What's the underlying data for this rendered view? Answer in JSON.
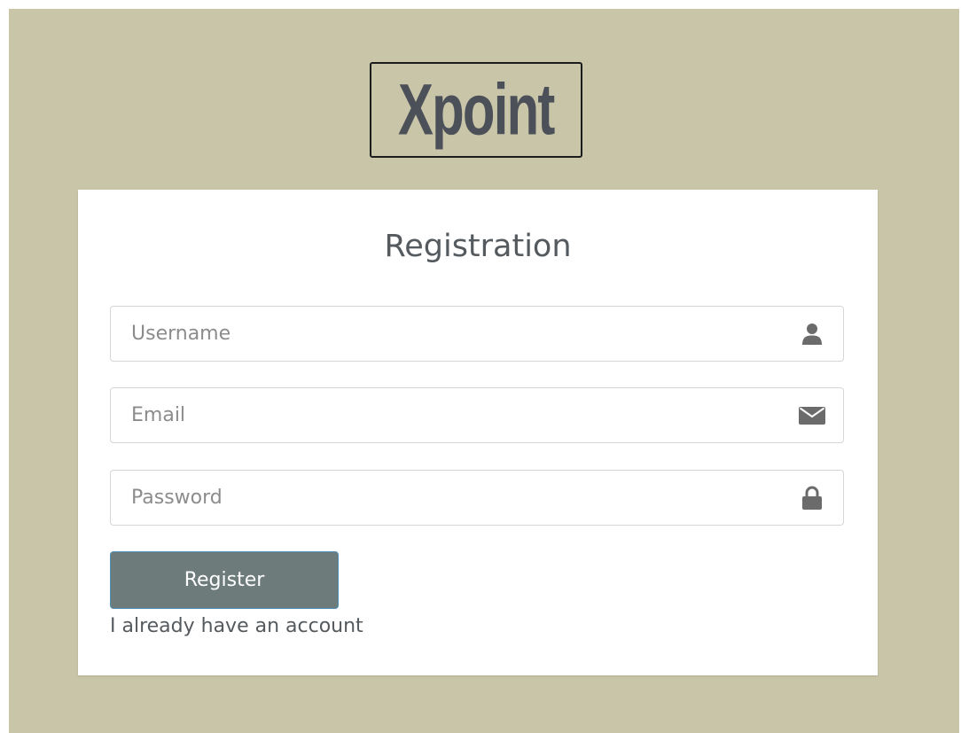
{
  "brand": {
    "logo_text": "Xpoint"
  },
  "form": {
    "title": "Registration",
    "username": {
      "value": "",
      "placeholder": "Username",
      "icon": "user-icon"
    },
    "email": {
      "value": "",
      "placeholder": "Email",
      "icon": "envelope-icon"
    },
    "password": {
      "value": "",
      "placeholder": "Password",
      "icon": "lock-icon"
    },
    "register_label": "Register",
    "login_link_label": "I already have an account"
  },
  "colors": {
    "page_background": "#c9c5a8",
    "card_background": "#ffffff",
    "button_background": "#6d7b7b",
    "button_border": "#4d8fb5",
    "text": "#555a5f",
    "icon": "#6b6b6b",
    "logo_text": "#4c5058"
  }
}
